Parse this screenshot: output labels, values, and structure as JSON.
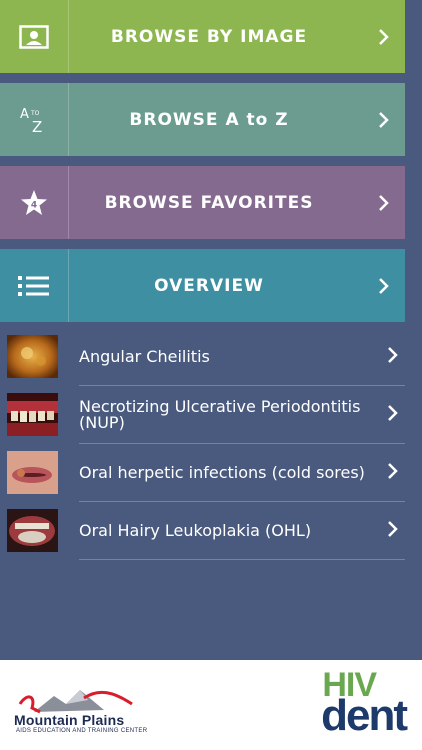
{
  "nav": {
    "browse_image": {
      "label": "BROWSE BY IMAGE",
      "icon": "image-icon",
      "color": "#8db650"
    },
    "browse_az": {
      "label": "BROWSE A to Z",
      "icon": "a-to-z-icon",
      "icon_top": "A",
      "icon_to": "TO",
      "icon_bottom": "Z",
      "color": "#6b9c8f"
    },
    "browse_favorites": {
      "label": "BROWSE FAVORITES",
      "icon": "star-icon",
      "badge": "4",
      "color": "#856a90"
    },
    "overview": {
      "label": "OVERVIEW",
      "icon": "list-icon",
      "color": "#3f8fa3"
    }
  },
  "list": {
    "items": [
      {
        "title": "Angular Cheilitis"
      },
      {
        "title": "Necrotizing Ulcerative Periodontitis (NUP)"
      },
      {
        "title": "Oral herpetic infections (cold sores)"
      },
      {
        "title": "Oral Hairy Leukoplakia (OHL)"
      }
    ]
  },
  "footer": {
    "left_logo": {
      "title": "Mountain Plains",
      "subtitle": "AIDS EDUCATION AND TRAINING CENTER"
    },
    "right_logo": {
      "top": "HIV",
      "bottom": "dent"
    }
  },
  "colors": {
    "background": "#4a5a7e",
    "accent_green": "#6aa84f",
    "accent_navy": "#1d3a6b"
  }
}
